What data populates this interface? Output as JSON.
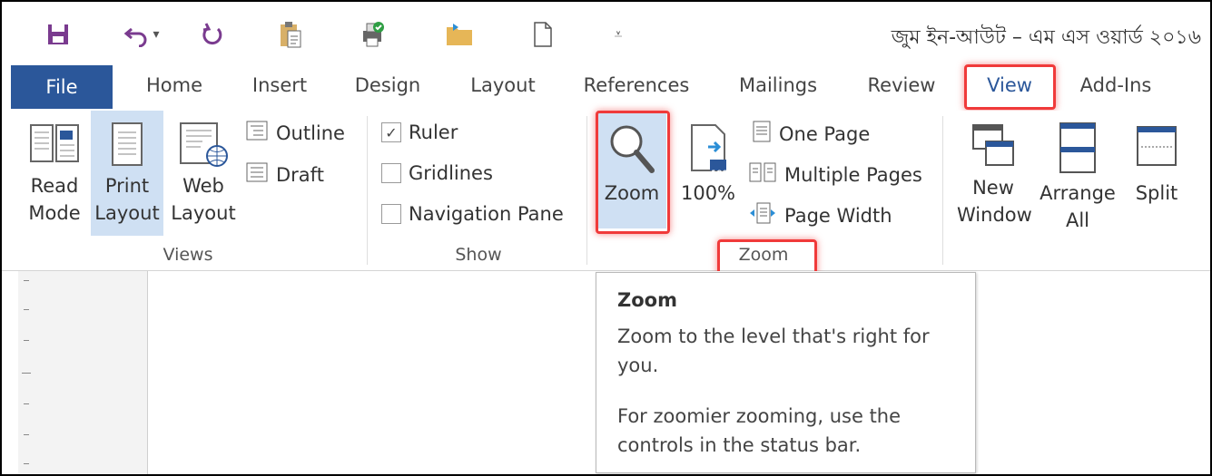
{
  "window": {
    "title": "জুম ইন-আউট – এম এস ওয়ার্ড ২০১৬"
  },
  "qat": {
    "icons": [
      "save-icon",
      "undo-icon",
      "undo-dropdown-icon",
      "redo-icon",
      "paste-icon",
      "print-preview-icon",
      "open-folder-icon",
      "new-document-icon",
      "customize-qat-icon"
    ],
    "undo_caret": "▾",
    "customize_glyph": "⩡"
  },
  "tabs": {
    "file": "File",
    "home": "Home",
    "insert": "Insert",
    "design": "Design",
    "layout": "Layout",
    "references": "References",
    "mailings": "Mailings",
    "review": "Review",
    "view": "View",
    "addins": "Add-Ins"
  },
  "ribbon": {
    "views": {
      "label": "Views",
      "read_mode_1": "Read",
      "read_mode_2": "Mode",
      "print_layout_1": "Print",
      "print_layout_2": "Layout",
      "web_layout_1": "Web",
      "web_layout_2": "Layout",
      "outline": "Outline",
      "draft": "Draft"
    },
    "show": {
      "label": "Show",
      "ruler": "Ruler",
      "gridlines": "Gridlines",
      "navigation_pane": "Navigation Pane",
      "ruler_checked": "✓"
    },
    "zoom": {
      "label": "Zoom",
      "zoom": "Zoom",
      "hundred": "100%",
      "hundred_badge": "100",
      "one_page": "One Page",
      "multiple_pages": "Multiple Pages",
      "page_width": "Page Width"
    },
    "window": {
      "new_window_1": "New",
      "new_window_2": "Window",
      "arrange_all_1": "Arrange",
      "arrange_all_2": "All",
      "split": "Split"
    }
  },
  "tooltip": {
    "title": "Zoom",
    "line1": "Zoom to the level that's right for",
    "line2": "you.",
    "line3": "For zoomier zooming, use the",
    "line4": "controls in the status bar."
  },
  "colors": {
    "file_tab": "#2b579a",
    "highlight": "#f03a3a",
    "selected": "#cfe0f3",
    "accent_purple": "#7a3b8f"
  }
}
